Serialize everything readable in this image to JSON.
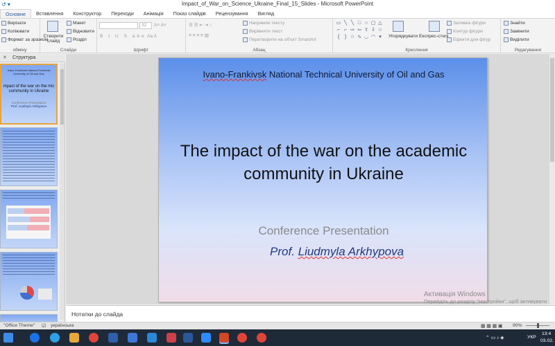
{
  "window": {
    "title": "Impact_of_War_on_Science_Ukraine_Final_15_Slides  -  Microsoft PowerPoint"
  },
  "tabs": [
    "Основне",
    "Вставлення",
    "Конструктор",
    "Переходи",
    "Анімація",
    "Показ слайдів",
    "Рецензування",
    "Вигляд"
  ],
  "ribbon": {
    "clipboard": {
      "cut": "Вирізати",
      "copy": "Копіювати",
      "format_painter": "Формат за зразком",
      "label": "обміну"
    },
    "slides": {
      "new_slide": "Створити слайд",
      "layout": "Макет",
      "reset": "Відновити",
      "section": "Розділ",
      "label": "Слайди"
    },
    "font": {
      "size": "32",
      "label": "Шрифт"
    },
    "paragraph": {
      "text_direction": "Напрямок тексту",
      "align_text": "Вирівняти текст",
      "smartart": "Перетворити на об'єкт SmartArt",
      "label": "Абзац"
    },
    "drawing": {
      "arrange": "Упорядкувати",
      "quick_styles": "Експрес-стилі",
      "shape_fill": "Заливка фігури",
      "shape_outline": "Контур фігури",
      "shape_effects": "Ефекти для фігур",
      "label": "Креслення"
    },
    "editing": {
      "find": "Знайти",
      "replace": "Замінити",
      "select": "Виділити",
      "label": "Редагування"
    }
  },
  "left_panel": {
    "tab_label": "Структура",
    "thumb1": {
      "univ": "Ivano-Frankivsk National Technical University of Oil and Gas",
      "title": "mpact of the war on the mic community in Ukraine",
      "subtitle": "Conference Presentation",
      "author": "Prof. Liudmyla Arkhypova"
    }
  },
  "slide": {
    "university": {
      "part1": "Ivano-Frankivsk",
      "part2": " National Technical University of Oil and Gas"
    },
    "title": "The impact of the war on the academic community in Ukraine",
    "subtitle": "Conference Presentation",
    "author": {
      "prefix": "Prof. ",
      "name": "Liudmyla Arkhypova"
    }
  },
  "watermark": {
    "line1": "Активація Windows",
    "line2": "Перейдіть до розділу \"Настройки\", щоб активувати Windows."
  },
  "notes": {
    "placeholder": "Нотатки до слайда"
  },
  "status": {
    "theme": "\"Office Theme\"",
    "language": "українська",
    "zoom": "90%"
  },
  "taskbar": {
    "lang": "УКР",
    "time": "13:4",
    "date": "03.02."
  }
}
